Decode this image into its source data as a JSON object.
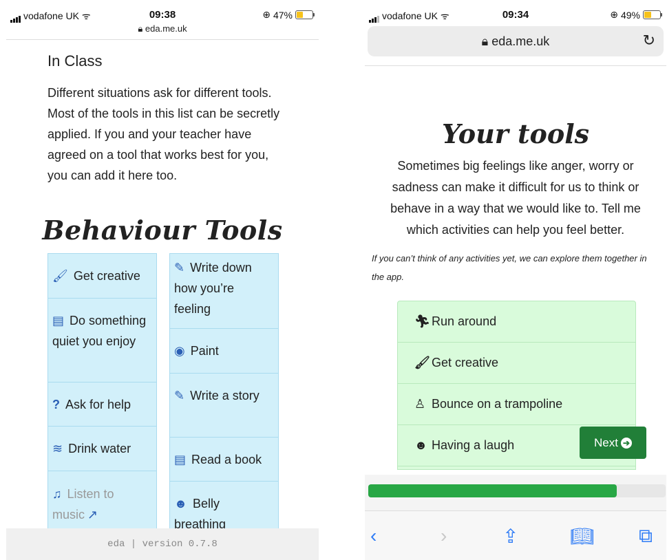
{
  "left": {
    "status": {
      "carrier": "vodafone UK",
      "time": "09:38",
      "battery": "47%",
      "battery_level": 0.47
    },
    "url": "eda.me.uk",
    "in_class_heading": "In Class",
    "in_class_text": "Different situations ask for different tools. Most of the tools in this list can be secretly applied. If you and your teacher have agreed on a tool that works best for you, you can add it here too.",
    "section_title": "Behaviour Tools",
    "tools_col_a": [
      {
        "icon": "paintbrush-icon",
        "glyph": "🖌",
        "label": "Get creative"
      },
      {
        "icon": "book-icon",
        "glyph": "▤",
        "label": "Do something quiet you enjoy"
      },
      {
        "icon": "question-icon",
        "glyph": "?",
        "label": "Ask for help"
      },
      {
        "icon": "water-icon",
        "glyph": "≋",
        "label": "Drink water"
      },
      {
        "icon": "music-icon",
        "glyph": "♫",
        "label": "Listen to music"
      }
    ],
    "tools_col_b": [
      {
        "icon": "pencil-icon",
        "glyph": "✎",
        "label": "Write down how you’re feeling"
      },
      {
        "icon": "palette-icon",
        "glyph": "◉",
        "label": "Paint"
      },
      {
        "icon": "pencil-icon",
        "glyph": "✎",
        "label": "Write a story"
      },
      {
        "icon": "book-icon",
        "glyph": "▤",
        "label": "Read a book"
      },
      {
        "icon": "smile-icon",
        "glyph": "☻",
        "label": "Belly breathing"
      }
    ],
    "footer": "eda | version 0.7.8"
  },
  "right": {
    "status": {
      "carrier": "vodafone UK",
      "time": "09:34",
      "battery": "49%",
      "battery_level": 0.49
    },
    "url": "eda.me.uk",
    "title": "Your tools",
    "description": "Sometimes big feelings like anger, worry or sadness can make it difficult for us to think or behave in a way that we would like to. Tell me which activities can help you feel better.",
    "note": "If you can’t think of any activities yet, we can explore them together in the app.",
    "activities": [
      {
        "icon": "running-icon",
        "glyph": "🏃",
        "label": "Run around"
      },
      {
        "icon": "paintbrush-icon",
        "glyph": "🖌",
        "label": "Get creative"
      },
      {
        "icon": "child-icon",
        "glyph": "🏃",
        "label": "Bounce on a trampoline"
      },
      {
        "icon": "laugh-icon",
        "glyph": "☻",
        "label": "Having a laugh"
      }
    ],
    "next_label": "Next",
    "progress_fraction": 0.835
  }
}
